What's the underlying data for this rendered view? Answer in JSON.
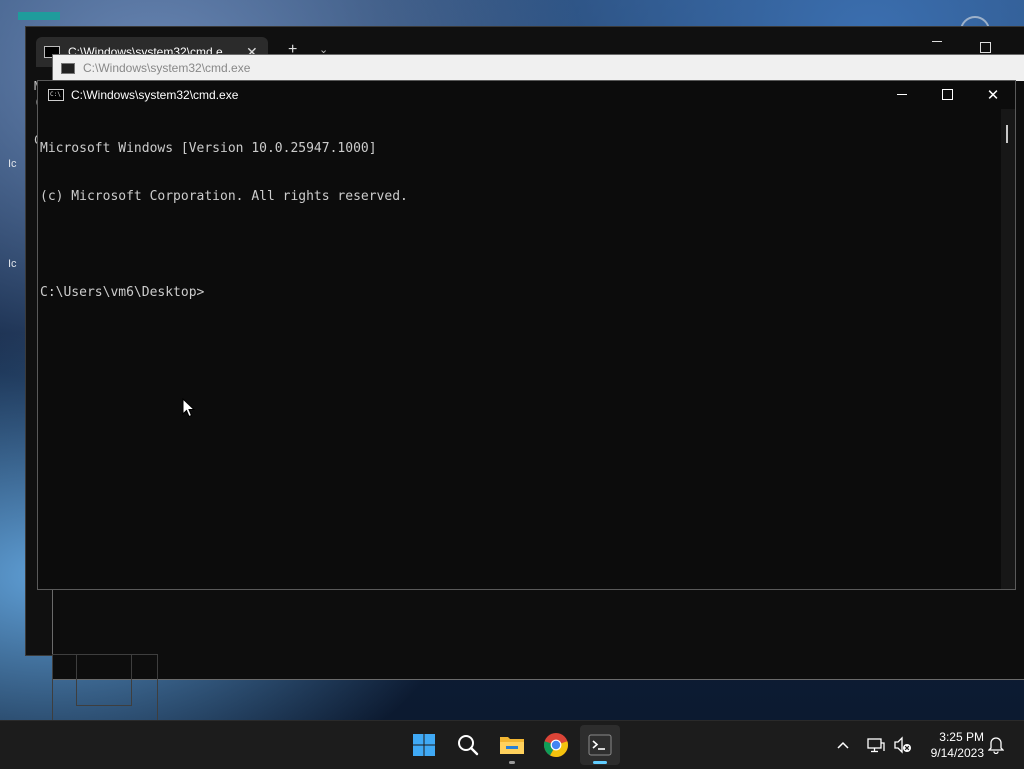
{
  "background_window": {
    "tab_label": "C:\\Windows\\system32\\cmd.e",
    "new_tab": "+",
    "dropdown": "⌄",
    "fragments": [
      "M",
      "(",
      "C"
    ]
  },
  "middle_window": {
    "title": "C:\\Windows\\system32\\cmd.exe"
  },
  "desktop_fragments": [
    "Ic",
    "Ic"
  ],
  "window": {
    "title": "C:\\Windows\\system32\\cmd.exe",
    "close_glyph": "✕",
    "icon_text": "C:\\"
  },
  "console": {
    "lines": [
      "Microsoft Windows [Version 10.0.25947.1000]",
      "(c) Microsoft Corporation. All rights reserved.",
      "",
      "C:\\Users\\vm6\\Desktop>"
    ]
  },
  "taskbar": {
    "apps": [
      {
        "name": "start",
        "icon": "windows-logo-icon"
      },
      {
        "name": "search",
        "icon": "search-icon"
      },
      {
        "name": "file-explorer",
        "icon": "folder-icon"
      },
      {
        "name": "chrome",
        "icon": "chrome-icon"
      },
      {
        "name": "terminal",
        "icon": "terminal-icon"
      }
    ],
    "terminal_glyph": ">_",
    "tray": {
      "chevron": "^",
      "icons": [
        "network-icon",
        "volume-muted-icon",
        "notification-bell-icon"
      ]
    },
    "clock": {
      "time": "3:25 PM",
      "date": "9/14/2023"
    }
  },
  "colors": {
    "console_bg": "#0c0c0c",
    "console_text": "#cccccc",
    "taskbar_bg": "#1c1c1c",
    "accent": "#60cdff"
  }
}
